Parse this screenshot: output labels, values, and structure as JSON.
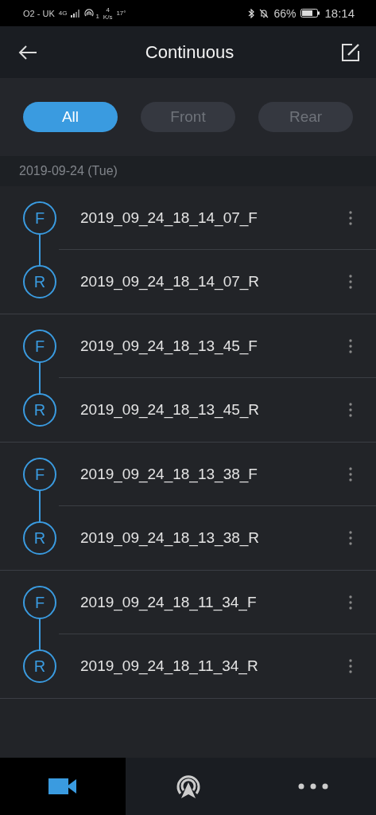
{
  "status_bar": {
    "carrier": "O2 - UK",
    "network": "4G",
    "hotspot_count": "1",
    "speed_value": "4",
    "speed_unit": "K/s",
    "temperature": "17°",
    "battery_percent": "66%",
    "time": "18:14"
  },
  "header": {
    "title": "Continuous"
  },
  "filters": [
    {
      "label": "All",
      "selected": true
    },
    {
      "label": "Front",
      "selected": false
    },
    {
      "label": "Rear",
      "selected": false
    }
  ],
  "date_header": "2019-09-24 (Tue)",
  "recordings": [
    {
      "items": [
        {
          "badge": "F",
          "name": "2019_09_24_18_14_07_F"
        },
        {
          "badge": "R",
          "name": "2019_09_24_18_14_07_R"
        }
      ]
    },
    {
      "items": [
        {
          "badge": "F",
          "name": "2019_09_24_18_13_45_F"
        },
        {
          "badge": "R",
          "name": "2019_09_24_18_13_45_R"
        }
      ]
    },
    {
      "items": [
        {
          "badge": "F",
          "name": "2019_09_24_18_13_38_F"
        },
        {
          "badge": "R",
          "name": "2019_09_24_18_13_38_R"
        }
      ]
    },
    {
      "items": [
        {
          "badge": "F",
          "name": "2019_09_24_18_11_34_F"
        },
        {
          "badge": "R",
          "name": "2019_09_24_18_11_34_R"
        }
      ]
    }
  ],
  "bottom_tabs": [
    {
      "kind": "camera",
      "selected": true
    },
    {
      "kind": "broadcast",
      "selected": false
    },
    {
      "kind": "more",
      "selected": false
    }
  ]
}
